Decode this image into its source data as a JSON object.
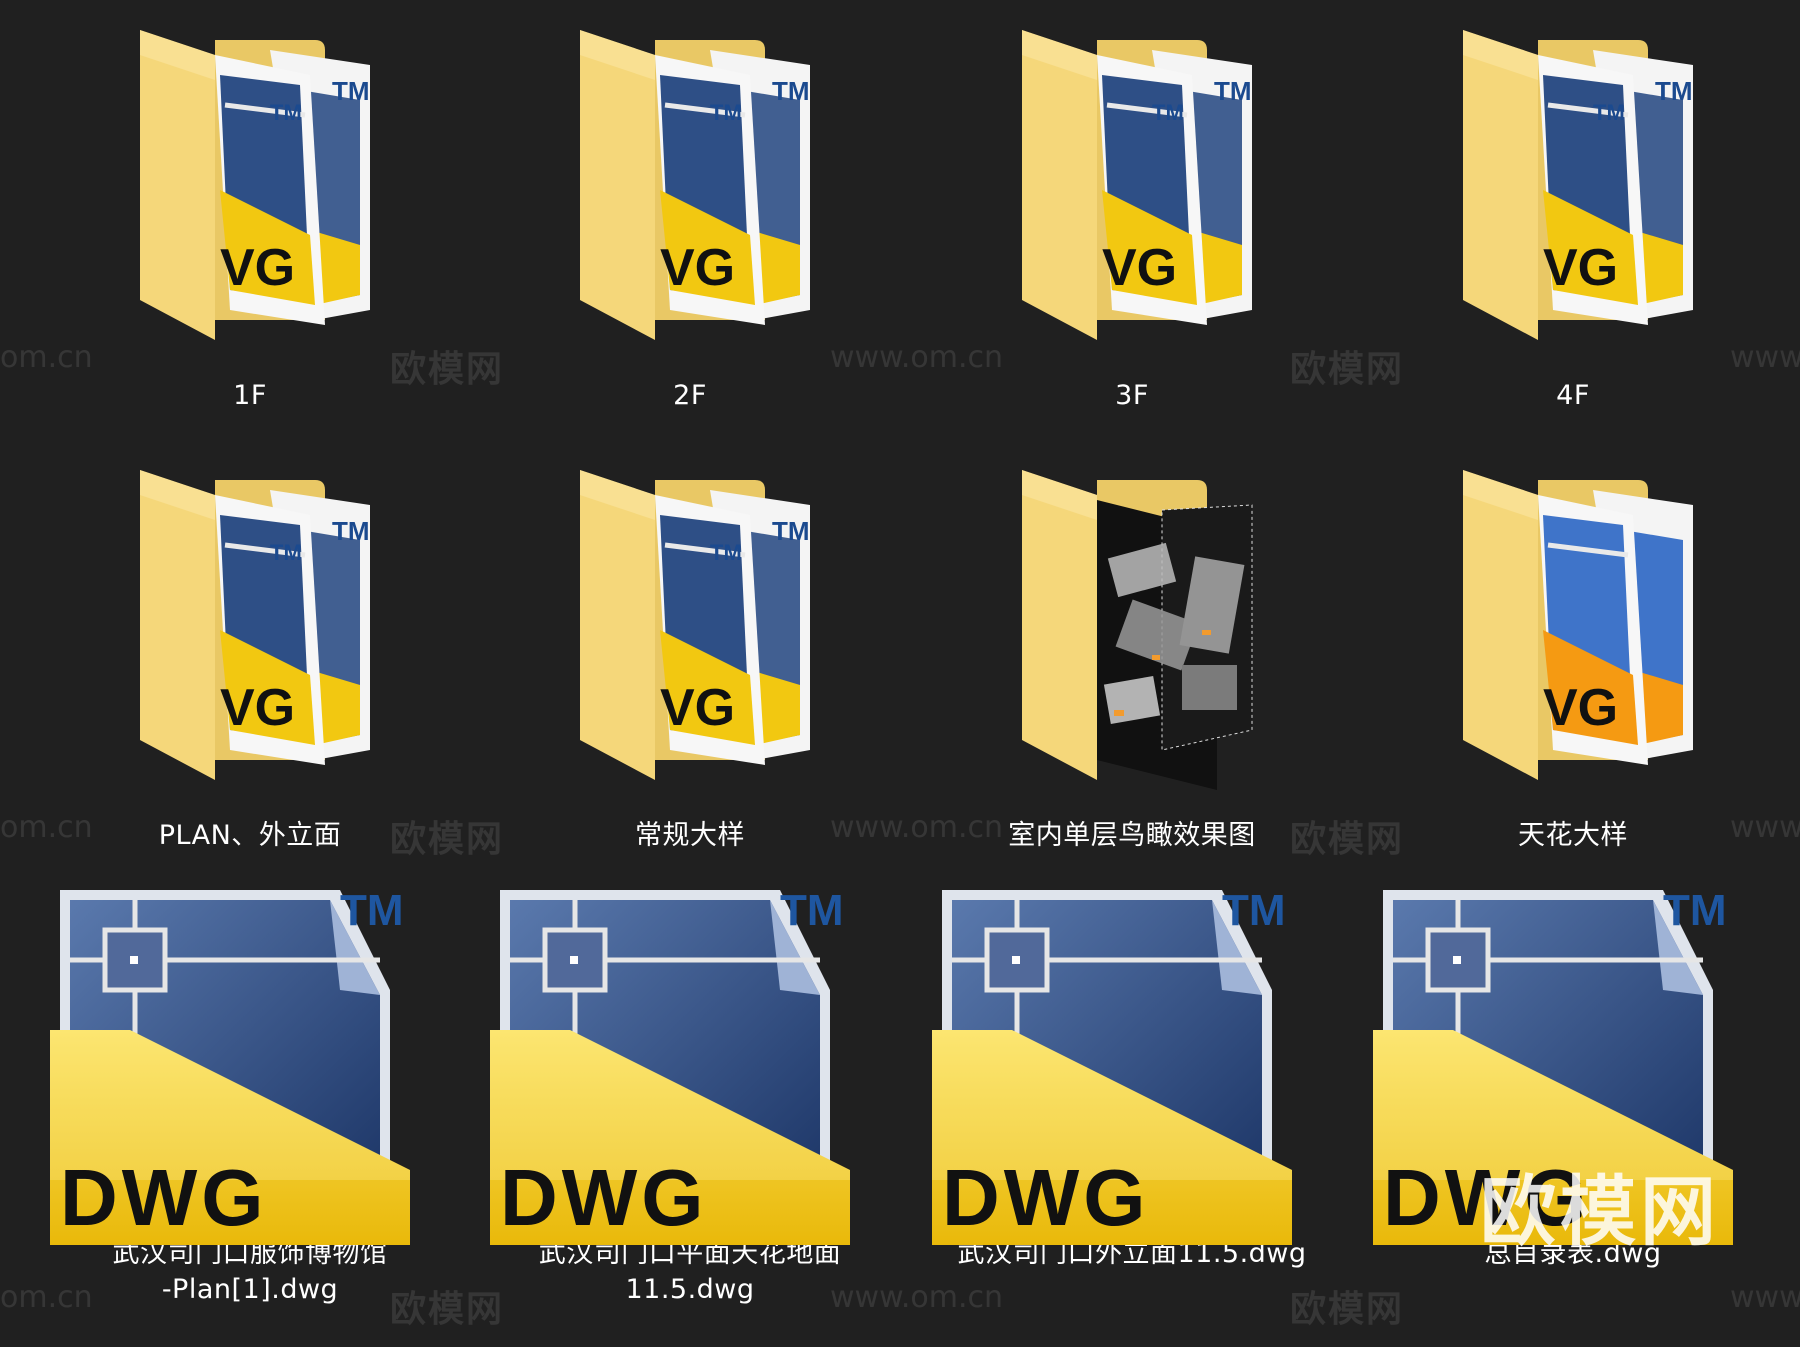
{
  "folders": [
    {
      "label": "1F",
      "kind": "dwg-folder",
      "icon": "dwg-folder-icon"
    },
    {
      "label": "2F",
      "kind": "dwg-folder",
      "icon": "dwg-folder-icon"
    },
    {
      "label": "3F",
      "kind": "dwg-folder",
      "icon": "dwg-folder-icon"
    },
    {
      "label": "4F",
      "kind": "dwg-folder",
      "icon": "dwg-folder-icon"
    },
    {
      "label": "PLAN、外立面",
      "kind": "dwg-folder",
      "icon": "dwg-folder-icon"
    },
    {
      "label": "常规大样",
      "kind": "dwg-folder",
      "icon": "dwg-folder-icon"
    },
    {
      "label": "室内单层鸟瞰效果图",
      "kind": "render-folder",
      "icon": "render-folder-icon"
    },
    {
      "label": "天花大样",
      "kind": "orange-dwg-folder",
      "icon": "orange-dwg-folder-icon"
    }
  ],
  "files": [
    {
      "label": "武汉司门口服饰博物馆\n-Plan[1].dwg",
      "icon": "dwg-file-icon"
    },
    {
      "label": "武汉司门口平面天花地面\n11.5.dwg",
      "icon": "dwg-file-icon"
    },
    {
      "label": "武汉司门口外立面11.5.dwg",
      "icon": "dwg-file-icon"
    },
    {
      "label": "总目录表.dwg",
      "icon": "dwg-file-icon"
    }
  ],
  "icon_text": {
    "dwg": "DWG",
    "tm": "TM",
    "vg": "VG"
  },
  "watermarks": {
    "site": "www.om.cn",
    "site_short": "om.cn",
    "brand": "欧模网"
  },
  "colors": {
    "background": "#202020",
    "folder": "#f5d77a",
    "dwg_yellow": "#f2c811",
    "dwg_blue": "#2e4f86",
    "orange": "#f59a12"
  }
}
